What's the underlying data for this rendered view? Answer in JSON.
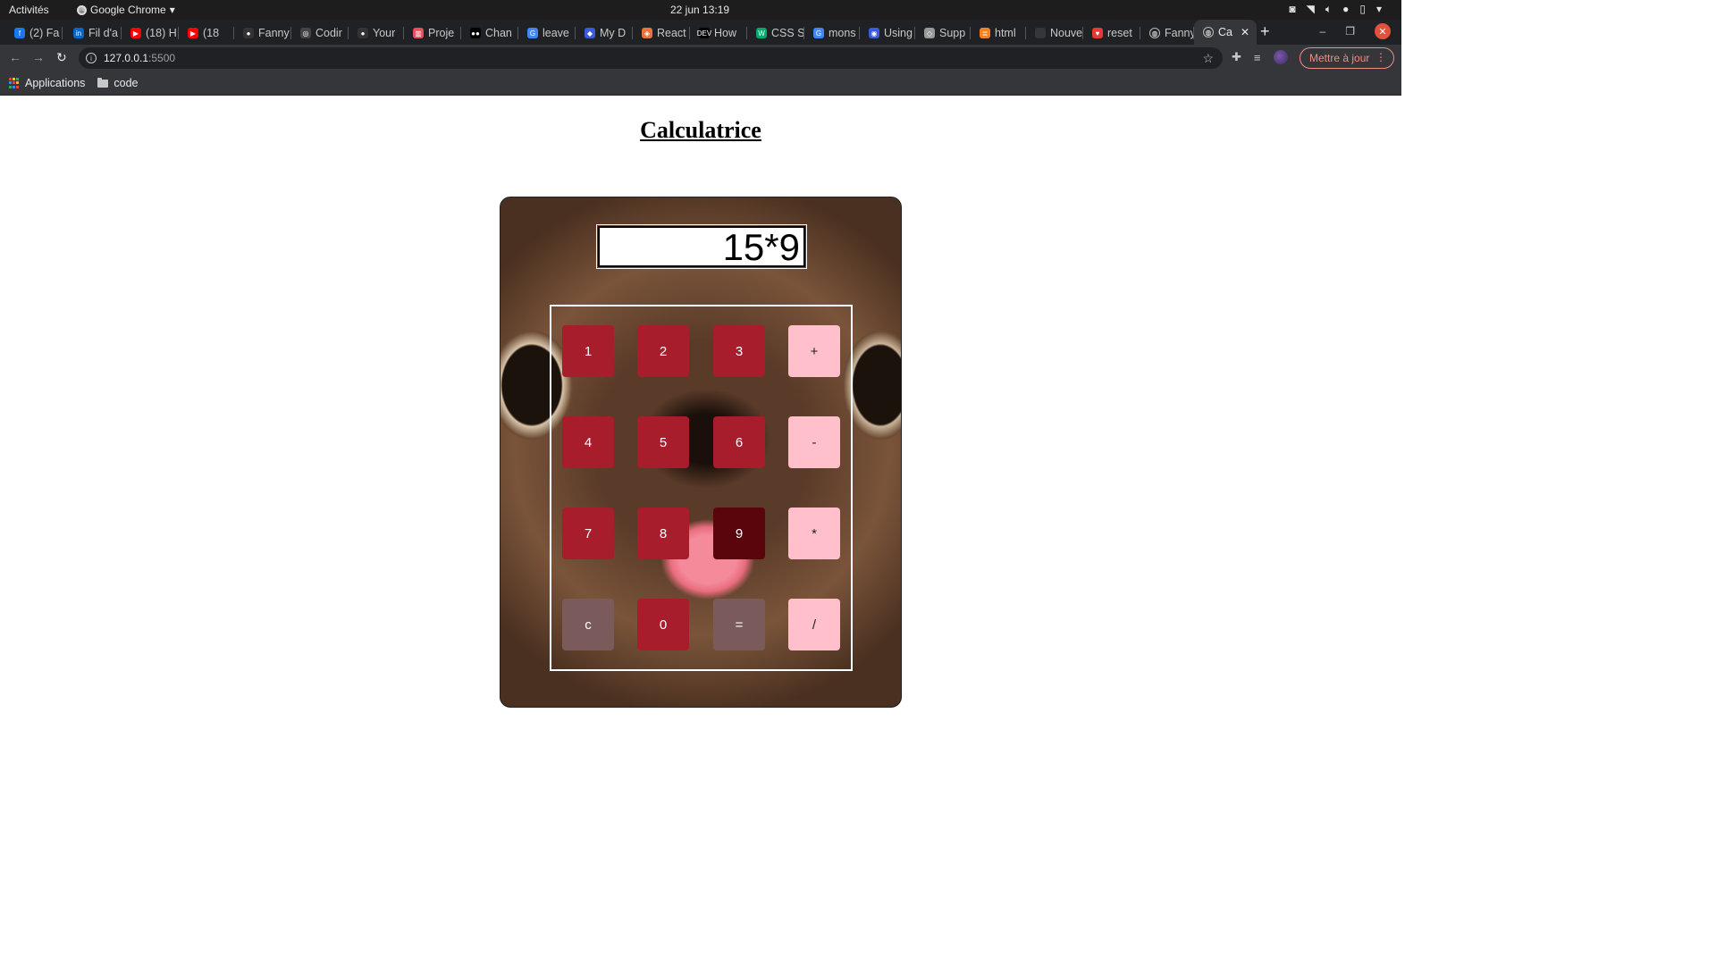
{
  "system_bar": {
    "activities": "Activités",
    "app_name": "Google Chrome",
    "clock": "22 jun  13:19"
  },
  "tabs": [
    {
      "label": "(2) Fa",
      "icon": "facebook-icon",
      "color": "#1877f2"
    },
    {
      "label": "Fil d'a",
      "icon": "linkedin-icon",
      "color": "#0a66c2"
    },
    {
      "label": "(18) H",
      "icon": "youtube-icon",
      "color": "#ff0000"
    },
    {
      "label": "(18",
      "icon": "youtube-icon",
      "color": "#ff0000"
    },
    {
      "label": "Fanny",
      "icon": "github-icon",
      "color": "#333333"
    },
    {
      "label": "Codir",
      "icon": "codingame-icon",
      "color": "#444444"
    },
    {
      "label": "Your",
      "icon": "github-icon",
      "color": "#333333"
    },
    {
      "label": "Proje",
      "icon": "trello-icon",
      "color": "#e84d5b"
    },
    {
      "label": "Chan",
      "icon": "medium-icon",
      "color": "#000000"
    },
    {
      "label": "leave",
      "icon": "google-icon",
      "color": "#4285f4"
    },
    {
      "label": "My D",
      "icon": "diagram-icon",
      "color": "#3b5bdb"
    },
    {
      "label": "React",
      "icon": "react-icon",
      "color": "#e8743b"
    },
    {
      "label": "How",
      "icon": "dev-icon",
      "color": "#000000"
    },
    {
      "label": "CSS S",
      "icon": "w3schools-icon",
      "color": "#04aa6d"
    },
    {
      "label": "mons",
      "icon": "google-icon",
      "color": "#4285f4"
    },
    {
      "label": "Using",
      "icon": "css-icon",
      "color": "#3b5bdb"
    },
    {
      "label": "Supp",
      "icon": "stack-icon",
      "color": "#999999"
    },
    {
      "label": "html",
      "icon": "stackoverflow-icon",
      "color": "#f48024"
    },
    {
      "label": "Nouvel o",
      "icon": "blank-icon",
      "color": "#35363a"
    },
    {
      "label": "reset",
      "icon": "heart-icon",
      "color": "#e53935"
    },
    {
      "label": "Fanny",
      "icon": "globe-icon",
      "color": "#bbbbbb"
    },
    {
      "label": "Ca",
      "icon": "globe-icon",
      "color": "#bbbbbb",
      "active": true
    }
  ],
  "address_bar": {
    "host": "127.0.0.1",
    "port": ":5500",
    "update_button": "Mettre à jour"
  },
  "bookmarks": [
    {
      "label": "Applications",
      "icon": "apps-grid-icon"
    },
    {
      "label": "code",
      "icon": "folder-icon"
    }
  ],
  "page": {
    "title": "Calculatrice",
    "display_value": "15*9",
    "keys": [
      {
        "label": "1",
        "kind": "digit"
      },
      {
        "label": "2",
        "kind": "digit"
      },
      {
        "label": "3",
        "kind": "digit"
      },
      {
        "label": "+",
        "kind": "op"
      },
      {
        "label": "4",
        "kind": "digit"
      },
      {
        "label": "5",
        "kind": "digit"
      },
      {
        "label": "6",
        "kind": "digit"
      },
      {
        "label": "-",
        "kind": "op"
      },
      {
        "label": "7",
        "kind": "digit"
      },
      {
        "label": "8",
        "kind": "digit"
      },
      {
        "label": "9",
        "kind": "digit",
        "pressed": true
      },
      {
        "label": "*",
        "kind": "op"
      },
      {
        "label": "c",
        "kind": "ctrl"
      },
      {
        "label": "0",
        "kind": "digit"
      },
      {
        "label": "=",
        "kind": "ctrl"
      },
      {
        "label": "/",
        "kind": "op"
      }
    ]
  },
  "colors": {
    "digit_key": "#a81d2c",
    "digit_key_pressed": "#5a040c",
    "operator_key": "#ffc0cb",
    "control_key": "#7a5a5a"
  }
}
